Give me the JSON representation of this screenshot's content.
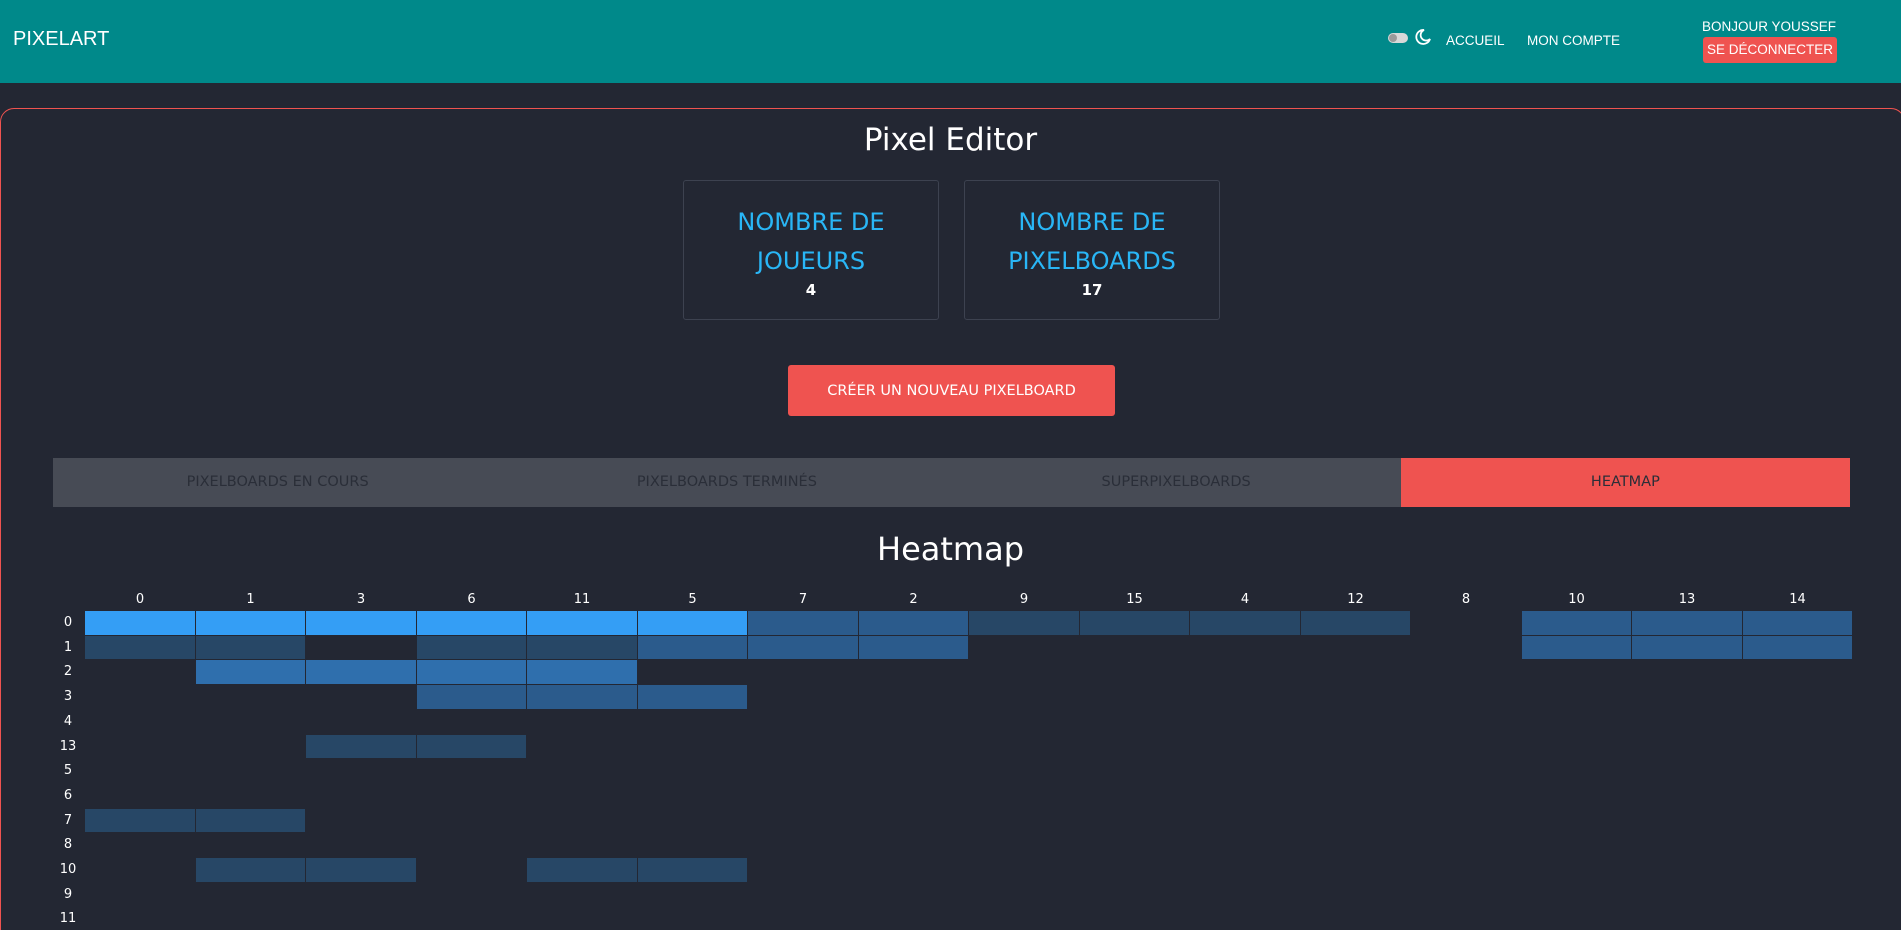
{
  "navbar": {
    "brand": "PIXELART",
    "links": [
      "ACCUEIL",
      "MON COMPTE"
    ],
    "greeting": "BONJOUR YOUSSEF",
    "logout_label": "SE DÉCONNECTER",
    "theme_icon": "moon-icon",
    "color": "#00898a"
  },
  "page": {
    "title": "Pixel Editor",
    "stats": [
      {
        "title": "NOMBRE DE JOUEURS",
        "value": "4"
      },
      {
        "title": "NOMBRE DE PIXELBOARDS",
        "value": "17"
      }
    ],
    "create_label": "CRÉER UN NOUVEAU PIXELBOARD",
    "accent_color": "#ef5350"
  },
  "tabs": [
    {
      "label": "PIXELBOARDS EN COURS",
      "active": false
    },
    {
      "label": "PIXELBOARDS TERMINÉS",
      "active": false
    },
    {
      "label": "SUPERPIXELBOARDS",
      "active": false
    },
    {
      "label": "HEATMAP",
      "active": true
    }
  ],
  "heatmap": {
    "title": "Heatmap",
    "columns": [
      "0",
      "1",
      "3",
      "6",
      "11",
      "5",
      "7",
      "2",
      "9",
      "15",
      "4",
      "12",
      "8",
      "10",
      "13",
      "14"
    ],
    "rows": [
      "0",
      "1",
      "2",
      "3",
      "4",
      "13",
      "5",
      "6",
      "7",
      "8",
      "10",
      "9",
      "11"
    ],
    "levels": [
      [
        4,
        4,
        4,
        4,
        4,
        4,
        2,
        2,
        1,
        1,
        1,
        1,
        0,
        2,
        2,
        2
      ],
      [
        1,
        1,
        0,
        1,
        1,
        2,
        2,
        2,
        0,
        0,
        0,
        0,
        0,
        2,
        2,
        2
      ],
      [
        0,
        3,
        3,
        3,
        3,
        0,
        0,
        0,
        0,
        0,
        0,
        0,
        0,
        0,
        0,
        0
      ],
      [
        0,
        0,
        0,
        2,
        2,
        2,
        0,
        0,
        0,
        0,
        0,
        0,
        0,
        0,
        0,
        0
      ],
      [
        0,
        0,
        0,
        0,
        0,
        0,
        0,
        0,
        0,
        0,
        0,
        0,
        0,
        0,
        0,
        0
      ],
      [
        0,
        0,
        1,
        1,
        0,
        0,
        0,
        0,
        0,
        0,
        0,
        0,
        0,
        0,
        0,
        0
      ],
      [
        0,
        0,
        0,
        0,
        0,
        0,
        0,
        0,
        0,
        0,
        0,
        0,
        0,
        0,
        0,
        0
      ],
      [
        0,
        0,
        0,
        0,
        0,
        0,
        0,
        0,
        0,
        0,
        0,
        0,
        0,
        0,
        0,
        0
      ],
      [
        1,
        1,
        0,
        0,
        0,
        0,
        0,
        0,
        0,
        0,
        0,
        0,
        0,
        0,
        0,
        0
      ],
      [
        0,
        0,
        0,
        0,
        0,
        0,
        0,
        0,
        0,
        0,
        0,
        0,
        0,
        0,
        0,
        0
      ],
      [
        0,
        1,
        1,
        0,
        1,
        1,
        0,
        0,
        0,
        0,
        0,
        0,
        0,
        0,
        0,
        0
      ],
      [
        0,
        0,
        0,
        0,
        0,
        0,
        0,
        0,
        0,
        0,
        0,
        0,
        0,
        0,
        0,
        0
      ],
      [
        0,
        0,
        0,
        0,
        0,
        0,
        0,
        0,
        0,
        0,
        0,
        0,
        0,
        0,
        0,
        0
      ]
    ],
    "level_colors": [
      "#232733",
      "#274766",
      "#2b5b8c",
      "#2f6fad",
      "#349ef5"
    ]
  }
}
